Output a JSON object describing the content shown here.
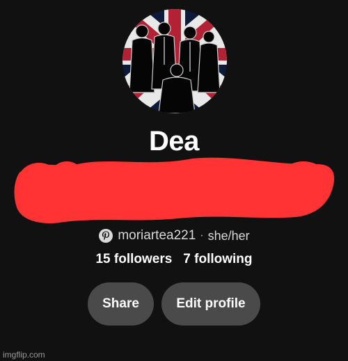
{
  "profile": {
    "display_name": "Dea",
    "handle": "moriartea221",
    "separator": "·",
    "pronouns": "she/her",
    "avatar_icon": "avatar-photo"
  },
  "stats": {
    "followers": "15 followers",
    "following": "7 following"
  },
  "actions": {
    "share_label": "Share",
    "edit_label": "Edit profile"
  },
  "watermark": "imgflip.com",
  "colors": {
    "background": "#111111",
    "button_bg": "#4a4a4a",
    "redaction": "#ff3333",
    "text": "#ffffff",
    "muted_text": "#d9d9d9"
  }
}
